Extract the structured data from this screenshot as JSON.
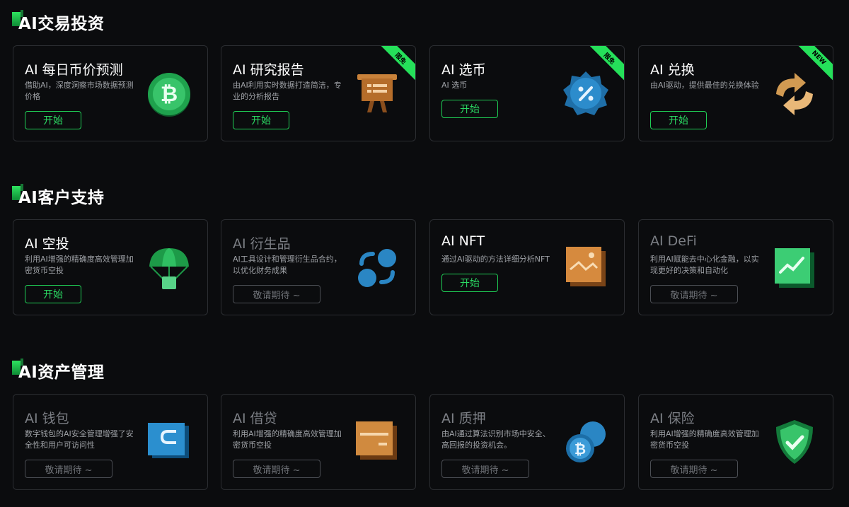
{
  "sections": [
    {
      "title": "AI交易投资"
    },
    {
      "title": "AI客户支持"
    },
    {
      "title": "AI资产管理"
    }
  ],
  "cards": [
    {
      "title": "AI 每日币价预测",
      "desc": "借助AI，深度洞察市场数据预测价格",
      "button": "开始",
      "badge": ""
    },
    {
      "title": "AI 研究报告",
      "desc": "由AI利用实时数据打造简洁，专业的分析报告",
      "button": "开始",
      "badge": "限免"
    },
    {
      "title": "AI 选币",
      "desc": "AI 选币",
      "button": "开始",
      "badge": "限免"
    },
    {
      "title": "AI 兑换",
      "desc": "由AI驱动，提供最佳的兑换体验",
      "button": "开始",
      "badge": "NEW"
    },
    {
      "title": "AI 空投",
      "desc": "利用AI增强的精确度高效管理加密货币空投",
      "button": "开始",
      "badge": ""
    },
    {
      "title": "AI 衍生品",
      "desc": "AI工具设计和管理衍生品合约，以优化财务成果",
      "button": "敬请期待 ~",
      "badge": ""
    },
    {
      "title": "AI NFT",
      "desc": "通过AI驱动的方法详细分析NFT",
      "button": "开始",
      "badge": ""
    },
    {
      "title": "AI DeFi",
      "desc": "利用AI赋能去中心化金融，以实现更好的决策和自动化",
      "button": "敬请期待 ~",
      "badge": ""
    },
    {
      "title": "AI 钱包",
      "desc": "数字钱包的AI安全管理增强了安全性和用户可访问性",
      "button": "敬请期待 ~",
      "badge": ""
    },
    {
      "title": "AI 借贷",
      "desc": "利用AI增强的精确度高效管理加密货币空投",
      "button": "敬请期待 ~",
      "badge": ""
    },
    {
      "title": "AI 质押",
      "desc": "由AI通过算法识别市场中安全、高回报的投资机会。",
      "button": "敬请期待 ~",
      "badge": ""
    },
    {
      "title": "AI 保险",
      "desc": "利用AI增强的精确度高效管理加密货币空投",
      "button": "敬请期待 ~",
      "badge": ""
    }
  ],
  "icons": [
    "bitcoin-coin-icon",
    "presentation-board-icon",
    "percent-badge-icon",
    "exchange-arrows-icon",
    "parachute-airdrop-icon",
    "derivatives-link-icon",
    "nft-image-icon",
    "defi-chart-icon",
    "wallet-icon",
    "loan-card-icon",
    "staking-coins-icon",
    "insurance-shield-icon"
  ],
  "colors": {
    "accent": "#25e05a",
    "background": "#0b0c0e",
    "border": "#2b2d31"
  }
}
